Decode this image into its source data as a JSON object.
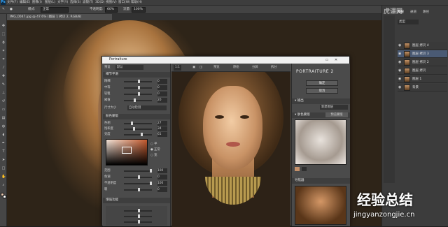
{
  "app": {
    "logo": "Ps"
  },
  "menubar": {
    "items": [
      "文件(F)",
      "编辑(E)",
      "图像(I)",
      "图层(L)",
      "文字(Y)",
      "选择(S)",
      "滤镜(T)",
      "3D(D)",
      "视图(V)",
      "窗口(W)",
      "帮助(H)"
    ]
  },
  "options": {
    "mode_label": "模式:",
    "mode_value": "正常",
    "opacity_label": "不透明度:",
    "opacity_value": "60%",
    "flow_label": "流量:",
    "flow_value": "100%"
  },
  "document": {
    "tab_title": "IMG_0047.jpg @ 47.6% (图层 1 拷贝 2, RGB/8)"
  },
  "panels": {
    "tabs": [
      "图层",
      "通道",
      "路径"
    ],
    "kind_label": "类型",
    "layers": [
      {
        "name": "图层 拷贝 4",
        "selected": false
      },
      {
        "name": "图层 拷贝 3",
        "selected": true
      },
      {
        "name": "图层 拷贝 2",
        "selected": false
      },
      {
        "name": "图层 拷贝",
        "selected": false
      },
      {
        "name": "图层 1",
        "selected": false
      },
      {
        "name": "背景",
        "selected": false
      }
    ]
  },
  "plugin": {
    "title": "Portraiture",
    "left": {
      "preset_label": "预设",
      "preset_value": "默认",
      "section1": "细节平滑",
      "rows1": [
        {
          "label": "精细",
          "value": "0"
        },
        {
          "label": "中等",
          "value": "0"
        },
        {
          "label": "较粗",
          "value": "0"
        },
        {
          "label": "阈值",
          "value": "20"
        }
      ],
      "size_label": "尺寸大小",
      "size_value": "自动检测",
      "section2": "肤色蒙版",
      "rows2": [
        {
          "label": "色相",
          "value": "27"
        },
        {
          "label": "饱和度",
          "value": "34"
        },
        {
          "label": "亮度",
          "value": "61"
        }
      ],
      "mask_options": [
        "平",
        "正常",
        "宽"
      ],
      "rows3": [
        {
          "label": "范围",
          "value": "100"
        },
        {
          "label": "色调",
          "value": "0"
        },
        {
          "label": "不透明度",
          "value": "100"
        },
        {
          "label": "暖",
          "value": "0"
        }
      ],
      "section3": "增强功能"
    },
    "toolbar": {
      "zoom": "1:1",
      "btn1": "预览",
      "btn2": "原始",
      "btn3": "分屏",
      "btn4": "拆分"
    },
    "right": {
      "logo": "PORTRAITURE 2",
      "ok": "确定",
      "cancel": "取消",
      "output_label": "输出",
      "output_value": "新建图层",
      "mask_section": "肤色蒙版",
      "mask_preview": "预览蒙版",
      "mini_section": "导航器"
    }
  },
  "watermark": {
    "big": "经验总结",
    "url": "jingyanzongjie.cn",
    "site": "虎课网"
  },
  "colors": {
    "selection": "#4a5a74",
    "accent": "#34a8ff"
  }
}
